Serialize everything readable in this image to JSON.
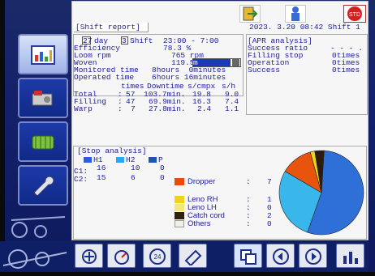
{
  "header": {
    "title": "Shift report",
    "datetime": "2023. 3.20 08:42  Shift 1"
  },
  "period": {
    "day_num": "27",
    "day_label": "day",
    "shift_num": "3",
    "shift_label": "Shift",
    "shift_time": "23:00 - 7:00"
  },
  "kpi": {
    "eff_label": "Efficiency",
    "eff_value": "78.3 %",
    "loom_label": "Loom rpm",
    "loom_value": "765 rpm",
    "woven_label": "Woven",
    "woven_value": "119.5",
    "woven_unit_selected": "m",
    "monitored_label": "Monitored time",
    "monitored_value": "8hours  0minutes",
    "operated_label": "Operated time",
    "operated_value": "6hours 16minutes"
  },
  "stops_table": {
    "headers": [
      "times",
      "Downtime",
      "s/cmpx",
      "s/h"
    ],
    "rows": [
      {
        "label": "Total",
        "times": "57",
        "downtime": "103.7min.",
        "scmpx": "19.8",
        "sh": "9.0"
      },
      {
        "label": "Filling",
        "times": "47",
        "downtime": "69.9min.",
        "scmpx": "16.3",
        "sh": "7.4"
      },
      {
        "label": "Warp",
        "times": "7",
        "downtime": "27.8min.",
        "scmpx": "2.4",
        "sh": "1.1"
      }
    ]
  },
  "apr": {
    "title": "[APR analysis]",
    "rows": [
      {
        "label": "Success ratio",
        "value": "- - - . - %"
      },
      {
        "label": "Filling stop",
        "value": "0times"
      },
      {
        "label": "Operation",
        "value": "0times"
      },
      {
        "label": "Success",
        "value": "0times"
      }
    ]
  },
  "stop_analysis": {
    "title": "[Stop analysis]",
    "legend": [
      "H1",
      "H2",
      "P"
    ],
    "legend_colors": [
      "#2a5de0",
      "#29a9f0",
      "#1a55b8"
    ],
    "rows": [
      {
        "label": "C1:",
        "values": [
          "16",
          "10",
          "0"
        ]
      },
      {
        "label": "C2:",
        "values": [
          "15",
          "6",
          "0"
        ]
      }
    ],
    "categories": [
      {
        "label": "Dropper",
        "value": "7",
        "color": "#e84a10"
      },
      {
        "label": "Leno RH",
        "value": "1",
        "color": "#f0d020"
      },
      {
        "label": "Leno LH",
        "value": "0",
        "color": "#f4e67a"
      },
      {
        "label": "Catch cord",
        "value": "2",
        "color": "#302010"
      },
      {
        "label": "Others",
        "value": "0",
        "color": "#f0f0e8"
      }
    ]
  },
  "pie": {
    "slices": [
      {
        "value": 31,
        "color": "#2f6fd8"
      },
      {
        "value": 16,
        "color": "#39b7ea"
      },
      {
        "value": 7,
        "color": "#e8540e"
      },
      {
        "value": 1,
        "color": "#efd41c"
      },
      {
        "value": 2,
        "color": "#2a1d10"
      }
    ]
  },
  "icons": {
    "top": [
      "logout-icon",
      "operator-icon",
      "stop-icon"
    ],
    "sidebar": [
      "report-chart-icon",
      "loom-machine-icon",
      "fabric-roll-icon",
      "wrench-icon"
    ],
    "bottom": [
      "weaving-icon",
      "speed-dial-icon",
      "timer-24-icon",
      "shuttle-icon",
      "copy-icon",
      "prev-icon",
      "next-icon",
      "bar-chart-icon"
    ]
  }
}
